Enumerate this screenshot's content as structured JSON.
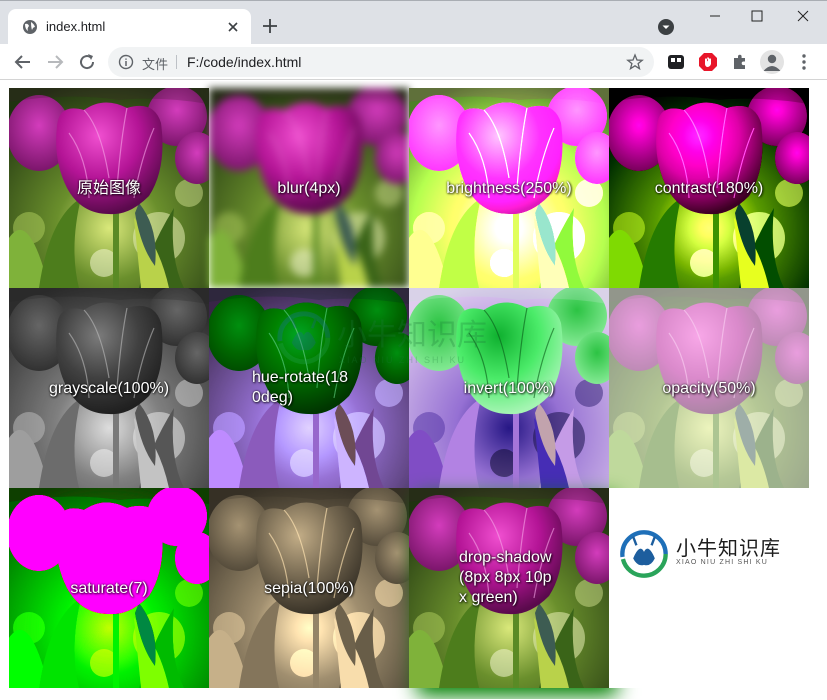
{
  "browser": {
    "tab_title": "index.html",
    "scheme_label": "文件",
    "url": "F:/code/index.html"
  },
  "logo": {
    "title": "小牛知识库",
    "subtitle": "XIAO NIU ZHI SHI KU"
  },
  "filters": [
    {
      "label": "原始图像",
      "css": "none"
    },
    {
      "label": "blur(4px)",
      "css": "blur(4px)"
    },
    {
      "label": "brightness(250%)",
      "css": "brightness(250%)"
    },
    {
      "label": "contrast(180%)",
      "css": "contrast(180%)"
    },
    {
      "label": "grayscale(100%)",
      "css": "grayscale(100%)"
    },
    {
      "label": "hue-rotate(180deg)",
      "css": "hue-rotate(180deg)"
    },
    {
      "label": "invert(100%)",
      "css": "invert(100%)"
    },
    {
      "label": "opacity(50%)",
      "css": "opacity(50%)"
    },
    {
      "label": "saturate(7)",
      "css": "saturate(7)"
    },
    {
      "label": "sepia(100%)",
      "css": "sepia(100%)"
    },
    {
      "label": "drop-shadow(8px 8px 10px green)",
      "css": "drop-shadow(8px 8px 10px green)"
    }
  ]
}
